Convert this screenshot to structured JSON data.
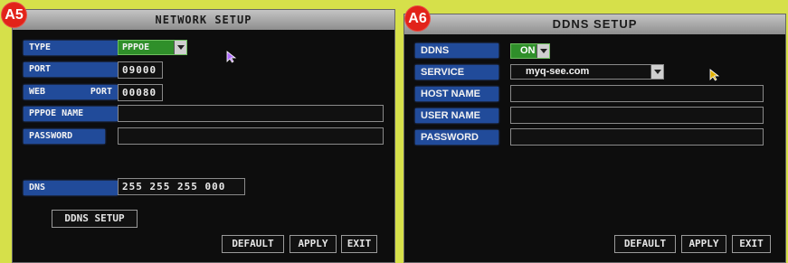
{
  "network": {
    "badge": "A5",
    "title": "NETWORK SETUP",
    "type_label": "TYPE",
    "type_value": "PPPOE",
    "port_label": "PORT",
    "port_value": "09000",
    "web_label_a": "WEB",
    "web_label_b": "PORT",
    "web_value": "00080",
    "pppoe_name_label": "PPPOE NAME",
    "pppoe_name_value": "",
    "password_label": "PASSWORD",
    "password_value": "",
    "dns_label": "DNS",
    "dns_value": "255 255 255 000",
    "ddns_setup_label": "DDNS SETUP",
    "default_label": "DEFAULT",
    "apply_label": "APPLY",
    "exit_label": "EXIT"
  },
  "ddns": {
    "badge": "A6",
    "title": "DDNS SETUP",
    "ddns_label": "DDNS",
    "ddns_value": "ON",
    "service_label": "SERVICE",
    "service_value": "myq-see.com",
    "host_name_label": "HOST NAME",
    "host_name_value": "",
    "user_name_label": "USER NAME",
    "user_name_value": "",
    "password_label": "PASSWORD",
    "password_value": "",
    "default_label": "DEFAULT",
    "apply_label": "APPLY",
    "exit_label": "EXIT"
  },
  "colors": {
    "background": "#d6e04a",
    "label_blue": "#214b9a",
    "combo_green": "#2f8f2a",
    "badge_red": "#e2231a"
  },
  "icons": [
    "mouse-pointer-icon",
    "dropdown-arrow-icon"
  ]
}
